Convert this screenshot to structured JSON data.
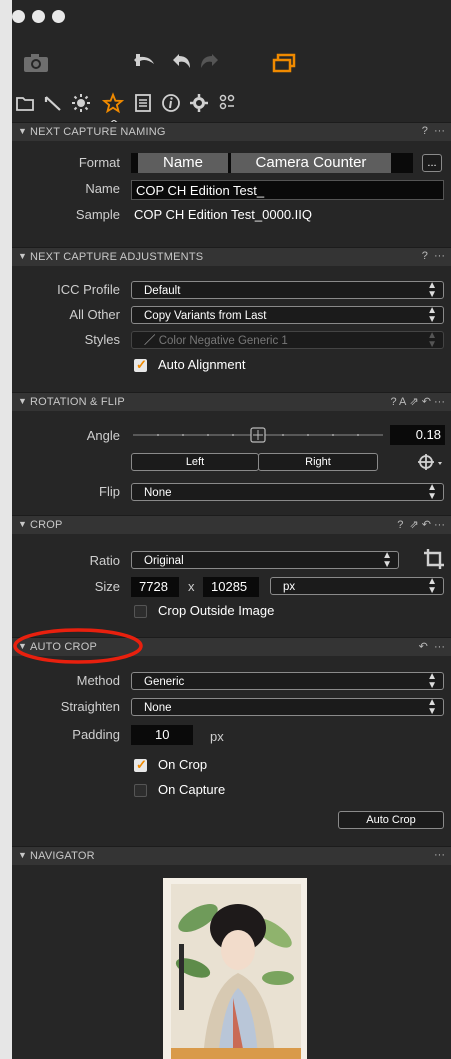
{
  "toolbar": {
    "undo": "undo-icon",
    "redo": "redo-icon"
  },
  "tabs": [
    "library",
    "adjust",
    "exposure",
    "favorite",
    "details",
    "info",
    "settings",
    "batch"
  ],
  "naming": {
    "title": "NEXT CAPTURE NAMING",
    "help": "?",
    "more": "···",
    "format_label": "Format",
    "format_tokens": [
      "Name",
      "Camera Counter"
    ],
    "format_more": "...",
    "name_label": "Name",
    "name_value": "COP CH Edition Test_",
    "sample_label": "Sample",
    "sample_value": "COP CH Edition Test_0000.IIQ"
  },
  "adjust": {
    "title": "NEXT CAPTURE ADJUSTMENTS",
    "help": "?",
    "more": "···",
    "icc_label": "ICC Profile",
    "icc_value": "Default",
    "allother_label": "All Other",
    "allother_value": "Copy Variants from Last",
    "styles_label": "Styles",
    "styles_value": "Color Negative Generic 1",
    "autoalign_label": "Auto Alignment",
    "autoalign_checked": true
  },
  "rotation": {
    "title": "ROTATION & FLIP",
    "right_tools": "? A",
    "more": "···",
    "angle_label": "Angle",
    "angle_value": "0.18",
    "left_btn": "Left",
    "right_btn": "Right",
    "flip_label": "Flip",
    "flip_value": "None"
  },
  "crop": {
    "title": "CROP",
    "help": "?",
    "more": "···",
    "ratio_label": "Ratio",
    "ratio_value": "Original",
    "size_label": "Size",
    "width": "7728",
    "x": "x",
    "height": "10285",
    "unit": "px",
    "outside_label": "Crop Outside Image",
    "outside_checked": false
  },
  "autocrop": {
    "title": "AUTO CROP",
    "more": "···",
    "method_label": "Method",
    "method_value": "Generic",
    "straighten_label": "Straighten",
    "straighten_value": "None",
    "padding_label": "Padding",
    "padding_value": "10",
    "padding_unit": "px",
    "oncrop_label": "On Crop",
    "oncrop_checked": true,
    "oncapture_label": "On Capture",
    "oncapture_checked": false,
    "button": "Auto Crop"
  },
  "navigator": {
    "title": "NAVIGATOR",
    "more": "···"
  },
  "colors": {
    "accent": "#f08a00",
    "highlight": "#e8200e",
    "panel": "#262626"
  }
}
